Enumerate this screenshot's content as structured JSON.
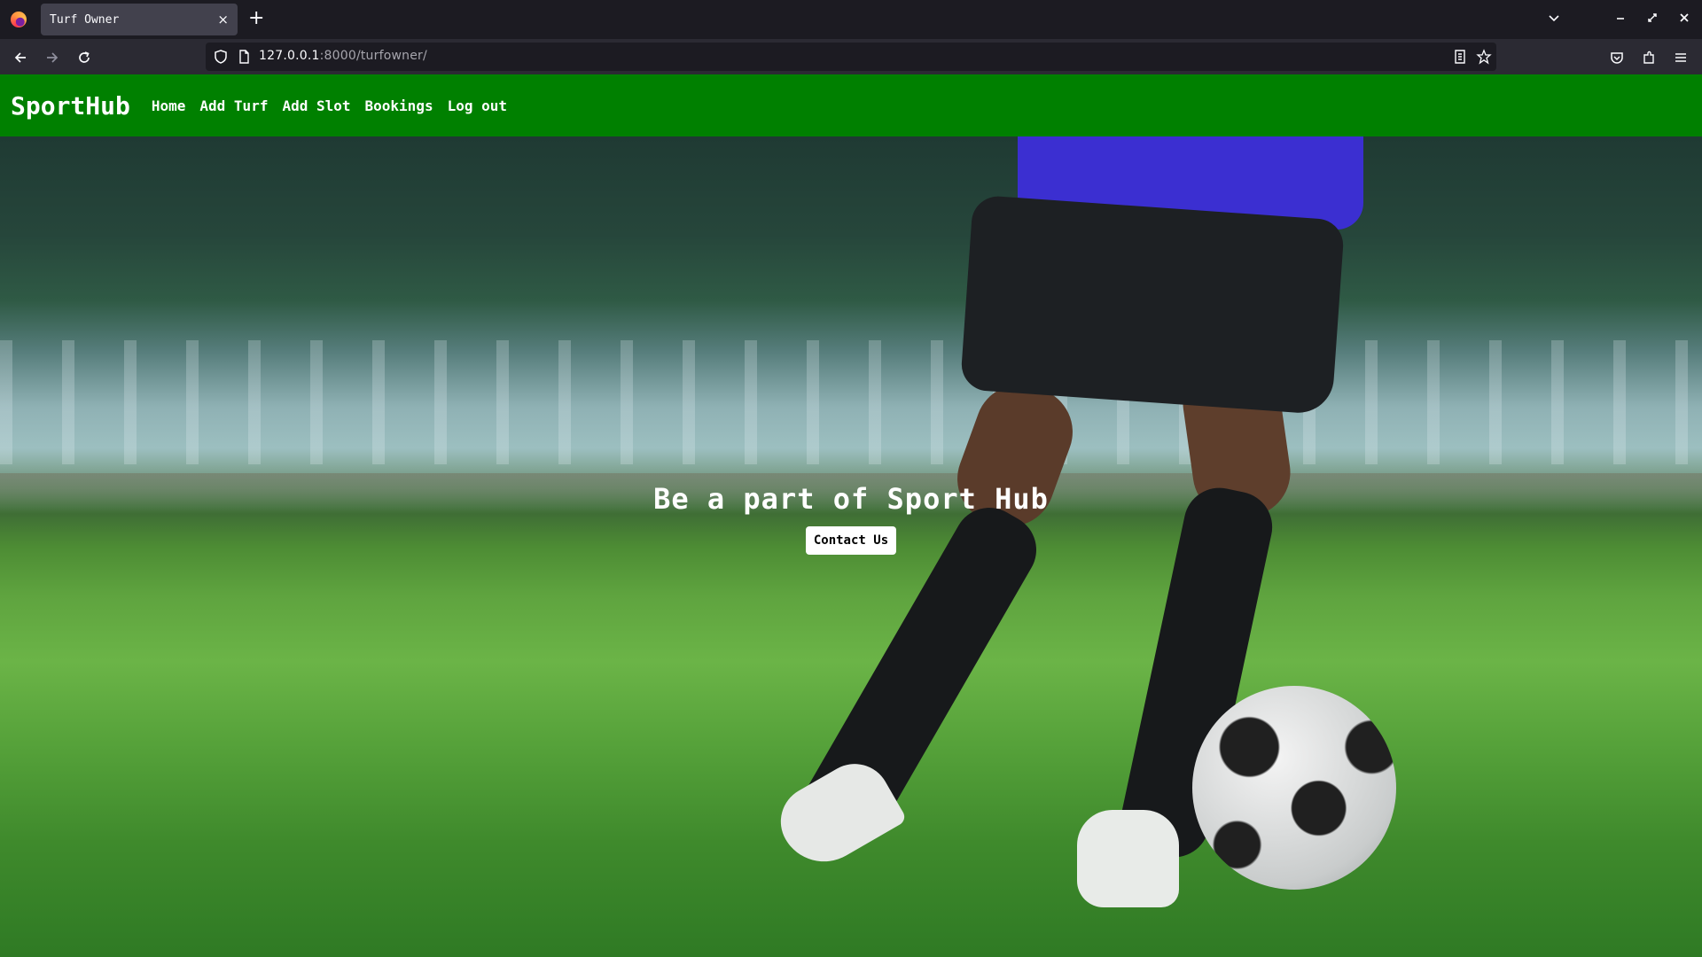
{
  "browser": {
    "tab_title": "Turf Owner",
    "tab_close": "×",
    "new_tab": "+",
    "url_host": "127.0.0.1",
    "url_rest": ":8000/turfowner/"
  },
  "site": {
    "brand": "SportHub",
    "nav": [
      "Home",
      "Add Turf",
      "Add Slot",
      "Bookings",
      "Log out"
    ],
    "accent_color": "#008000"
  },
  "hero": {
    "title": "Be a part of Sport Hub",
    "cta_label": "Contact Us"
  }
}
